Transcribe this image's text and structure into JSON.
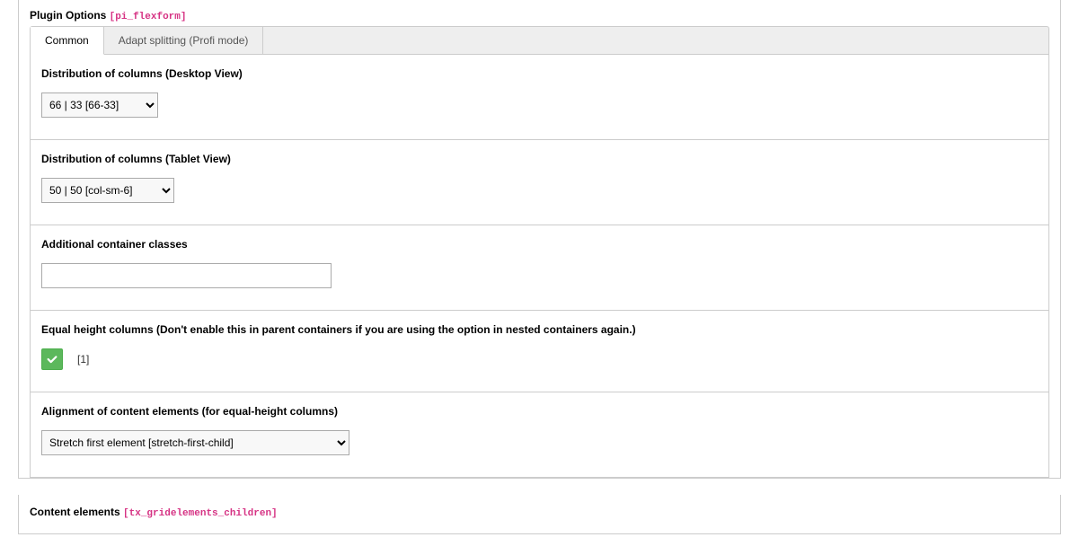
{
  "plugin_options": {
    "title": "Plugin Options",
    "tech": "[pi_flexform]"
  },
  "tabs": {
    "common": "Common",
    "adapt": "Adapt splitting (Profi mode)"
  },
  "fields": {
    "desktop": {
      "label": "Distribution of columns (Desktop View)",
      "value": "66 | 33 [66-33]"
    },
    "tablet": {
      "label": "Distribution of columns (Tablet View)",
      "value": "50 | 50 [col-sm-6]"
    },
    "container_classes": {
      "label": "Additional container classes",
      "value": ""
    },
    "equal_height": {
      "label": "Equal height columns (Don't enable this in parent containers if you are using the option in nested containers again.)",
      "value_display": "[1]"
    },
    "alignment": {
      "label": "Alignment of content elements (for equal-height columns)",
      "value": "Stretch first element [stretch-first-child]"
    }
  },
  "content_elements": {
    "title": "Content elements",
    "tech": "[tx_gridelements_children]"
  }
}
